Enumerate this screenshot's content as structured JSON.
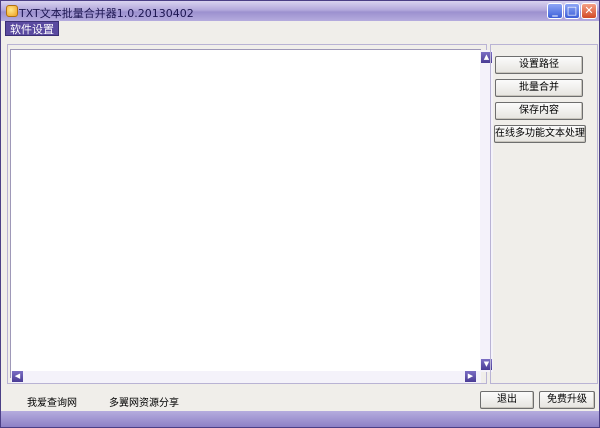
{
  "window": {
    "title": "TXT文本批量合并器1.0.20130402",
    "controls": {
      "minimize": "_",
      "maximize": "□",
      "close": "✕"
    },
    "icon": "app-icon"
  },
  "menu": {
    "items": [
      {
        "label": "软件设置"
      }
    ]
  },
  "editor": {
    "text": "",
    "scroll_up": "▲",
    "scroll_down": "▼",
    "scroll_left": "◀",
    "scroll_right": "▶"
  },
  "actions": {
    "set_path": "设置路径",
    "merge": "批量合并",
    "save": "保存内容",
    "online_tool": "在线多功能文本处理"
  },
  "footer": {
    "link1": "我爱查询网",
    "link2": "多翼网资源分享",
    "exit": "退出",
    "upgrade": "免费升级"
  },
  "colors": {
    "titlebar": "#b3a9dc",
    "frame": "#7a6fae",
    "menu_highlight": "#5a4aa0",
    "background": "#f0eeea"
  }
}
